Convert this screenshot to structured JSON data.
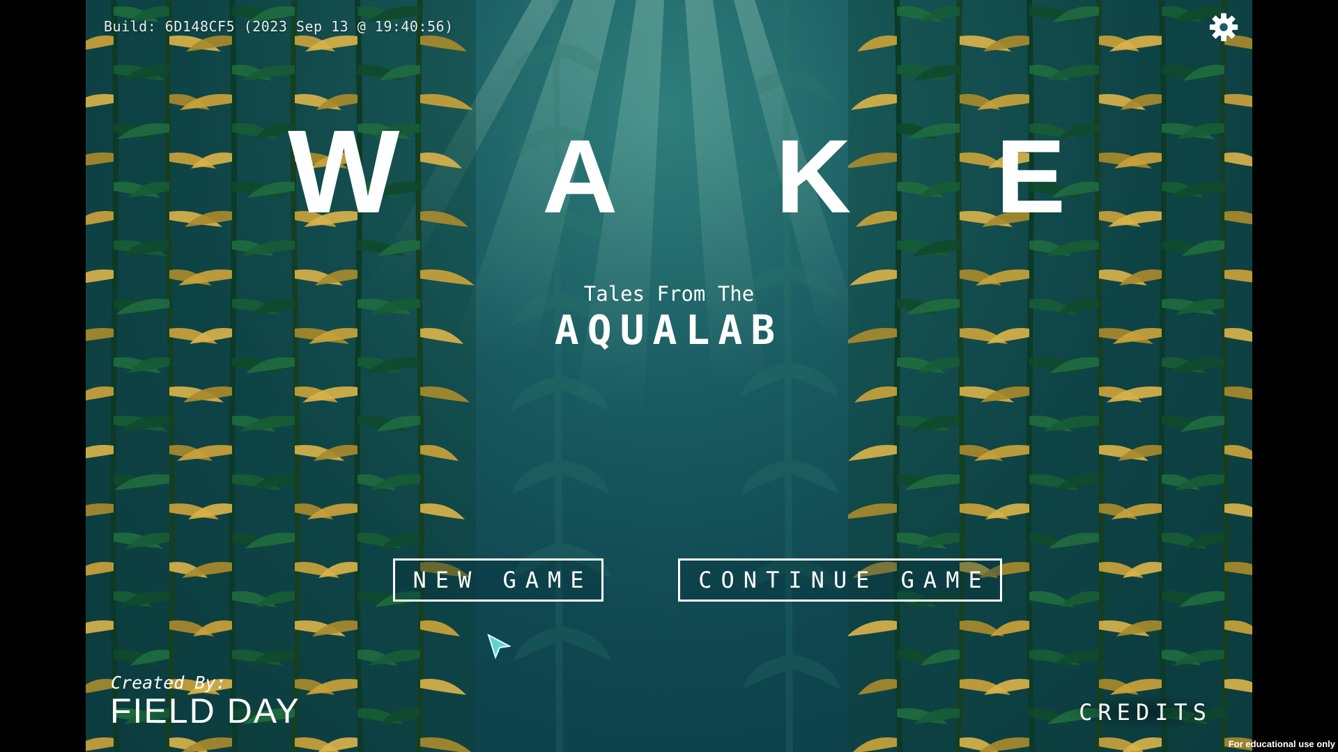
{
  "build": {
    "text": "Build: 6D148CF5 (2023 Sep 13 @ 19:40:56)"
  },
  "settings": {
    "icon": "gear-icon"
  },
  "logo": {
    "text": "WAKE",
    "letters": [
      "W",
      "A",
      "K",
      "E"
    ]
  },
  "subtitle": {
    "line1": "Tales From The",
    "line2": "AQUALAB"
  },
  "menu": {
    "new_game": "NEW GAME",
    "continue_game": "CONTINUE GAME"
  },
  "footer": {
    "created_by": "Created By:",
    "studio": "FIELD DAY",
    "credits": "CREDITS"
  },
  "notice": "For educational use only",
  "colors": {
    "water_deep": "#0b3a44",
    "water_light": "#2f7f7c",
    "kelp_dark": "#0f3d2c",
    "kelp_green": "#1e6b3f",
    "kelp_gold": "#c9a23a",
    "text": "#ffffff"
  }
}
